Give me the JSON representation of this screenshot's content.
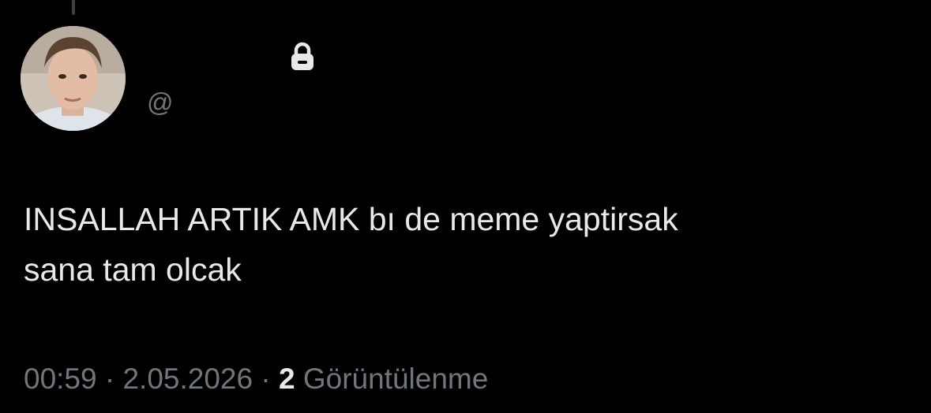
{
  "tweet": {
    "author": {
      "display_name": "",
      "handle": "@",
      "protected_icon": "lock-icon",
      "avatar_icon": "profile-photo"
    },
    "text_lines": [
      "INSALLAH ARTIK AMK bı de meme yaptirsak",
      "sana tam olcak"
    ],
    "meta": {
      "time": "00:59",
      "separator": "·",
      "date": "2.05.2026",
      "views_count": "2",
      "views_label": "Görüntülenme"
    }
  },
  "colors": {
    "background": "#000000",
    "primary_text": "#e7e9ea",
    "secondary_text": "#71767b",
    "thread_line": "#3e4144"
  }
}
